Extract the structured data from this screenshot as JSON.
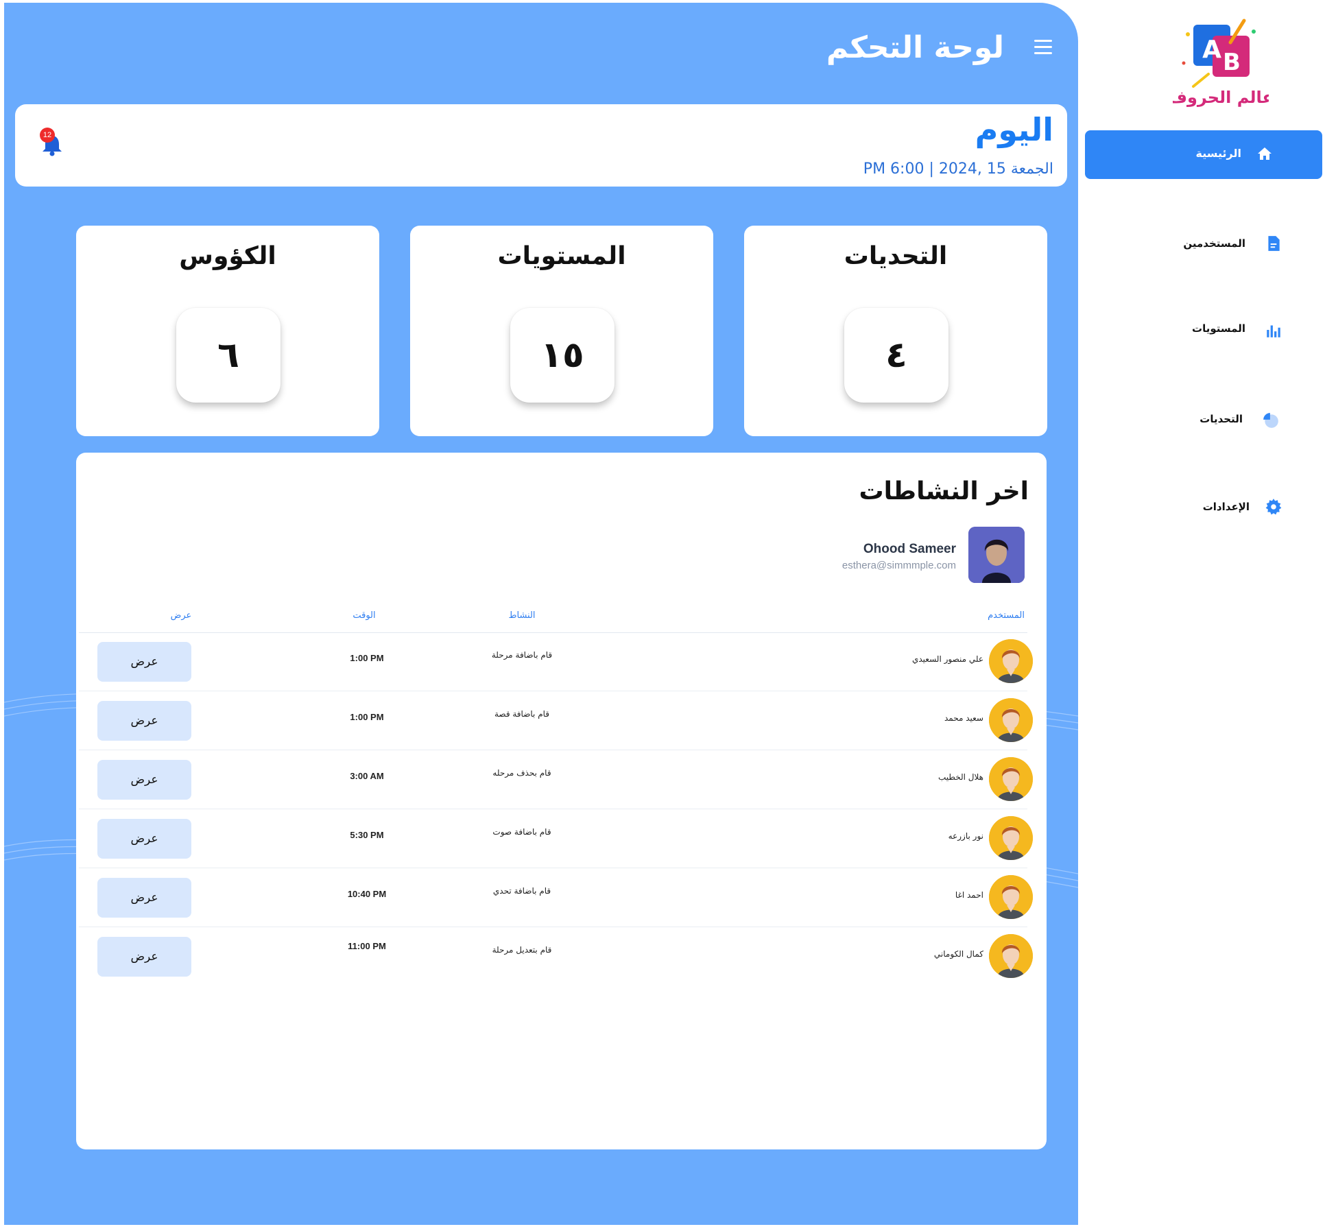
{
  "app": {
    "brand_text": "عالم الحروف",
    "brand_letters": [
      "A",
      "B"
    ],
    "accent_color": "#2f86f6",
    "panel_color": "#6aabfd"
  },
  "sidebar": {
    "items": [
      {
        "label": "الرئيسية",
        "icon": "home-icon",
        "active": true
      },
      {
        "label": "المستخدمين",
        "icon": "document-icon",
        "active": false
      },
      {
        "label": "المستويات",
        "icon": "bar-chart-icon",
        "active": false
      },
      {
        "label": "التحديات",
        "icon": "pie-chart-icon",
        "active": false
      },
      {
        "label": "الإعدادات",
        "icon": "gear-icon",
        "active": false
      }
    ]
  },
  "header": {
    "title": "لوحة التحكم",
    "menu_icon": "menu-icon"
  },
  "today": {
    "title": "اليوم",
    "date": "الجمعة 15 ,2024 | 6:00 PM",
    "notifications": "12"
  },
  "stats": [
    {
      "title": "الكؤوس",
      "value": "٦"
    },
    {
      "title": "المستويات",
      "value": "١٥"
    },
    {
      "title": "التحديات",
      "value": "٤"
    }
  ],
  "activities": {
    "title": "اخر النشاطات",
    "profile": {
      "name": "Ohood Sameer",
      "email": "esthera@simmmple.com"
    },
    "columns": {
      "user": "المستخدم",
      "activity": "النشاط",
      "time": "الوقت",
      "view": "عرض"
    },
    "rows": [
      {
        "user": "علي منصور السعيدي",
        "activity": "قام باضافة مرحلة",
        "time": "1:00 PM",
        "action": "عرض"
      },
      {
        "user": "سعيد محمد",
        "activity": "قام باضافة قصة",
        "time": "1:00 PM",
        "action": "عرض"
      },
      {
        "user": "هلال الخطيب",
        "activity": "قام بحذف مرحله",
        "time": "3:00 AM",
        "action": "عرض"
      },
      {
        "user": "نور بازرعه",
        "activity": "قام باضافة صوت",
        "time": "5:30 PM",
        "action": "عرض"
      },
      {
        "user": "احمد اغا",
        "activity": "قام باضافة تحدي",
        "time": "10:40 PM",
        "action": "عرض"
      },
      {
        "user": "كمال الكوماني",
        "activity": "قام بتعديل مرحلة",
        "time": "11:00 PM",
        "action": "عرض"
      }
    ]
  }
}
